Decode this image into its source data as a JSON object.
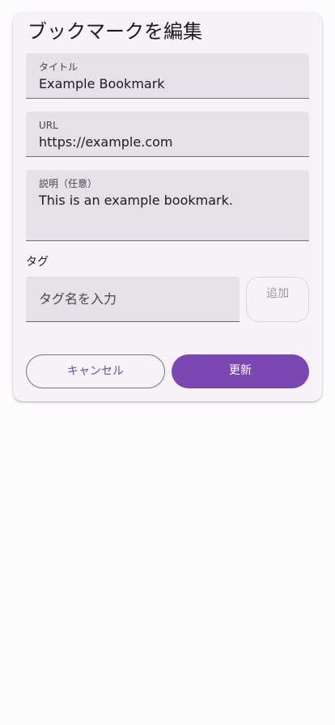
{
  "dialog": {
    "title": "ブックマークを編集"
  },
  "fields": {
    "title": {
      "label": "タイトル",
      "value": "Example Bookmark"
    },
    "url": {
      "label": "URL",
      "value": "https://example.com"
    },
    "description": {
      "label": "説明（任意）",
      "value": "This is an example bookmark."
    }
  },
  "tags": {
    "label": "タグ",
    "input_placeholder": "タグ名を入力",
    "add_label": "追加"
  },
  "actions": {
    "cancel_label": "キャンセル",
    "update_label": "更新"
  },
  "colors": {
    "accent": "#7b47b0",
    "outline_text": "#6750a4"
  }
}
